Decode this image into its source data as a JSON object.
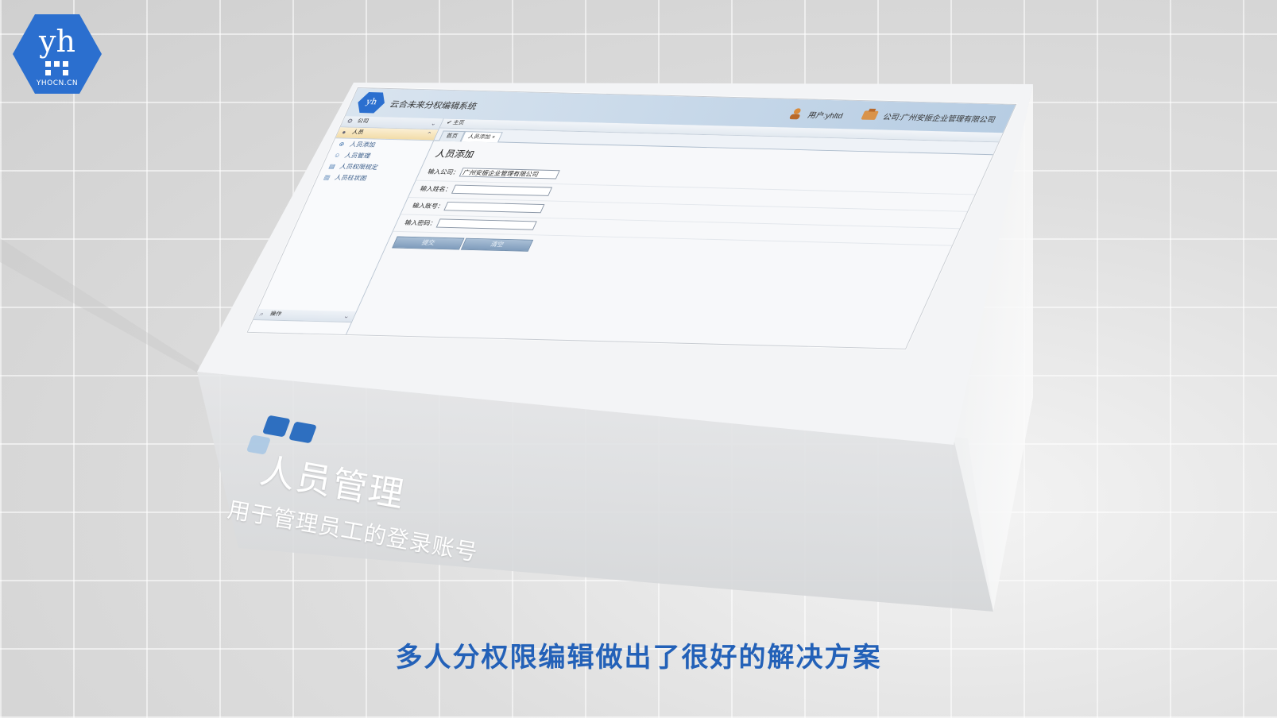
{
  "logo": {
    "mark": "yh",
    "site": "YHOCN.CN",
    "color": "#2b6fcf"
  },
  "app": {
    "title": "云合未来分权编辑系统",
    "user_label": "用户:yhltd",
    "company_label": "公司:广州安振企业管理有限公司",
    "sidebar": {
      "panel_company": "公司",
      "panel_people": "人员",
      "items": [
        {
          "label": "人员添加",
          "icon": "add-circle-icon"
        },
        {
          "label": "人员管理",
          "icon": "users-icon"
        },
        {
          "label": "人员权限规定",
          "icon": "book-icon"
        },
        {
          "label": "人员柱状图",
          "icon": "bar-chart-icon"
        }
      ],
      "panel_ops": "操作"
    },
    "main": {
      "breadcrumb": "主页",
      "tabs": [
        {
          "label": "首页"
        },
        {
          "label": "人员添加"
        }
      ],
      "form_title": "人员添加",
      "fields": [
        {
          "label": "输入公司：",
          "value": "广州安振企业管理有限公司"
        },
        {
          "label": "输入姓名：",
          "value": ""
        },
        {
          "label": "输入账号：",
          "value": ""
        },
        {
          "label": "输入密码：",
          "value": ""
        }
      ],
      "submit_label": "提交",
      "clear_label": "清空"
    }
  },
  "caption": {
    "title": "人员管理",
    "description": "用于管理员工的登录账号"
  },
  "subtitle": "多人分权限编辑做出了很好的解决方案"
}
